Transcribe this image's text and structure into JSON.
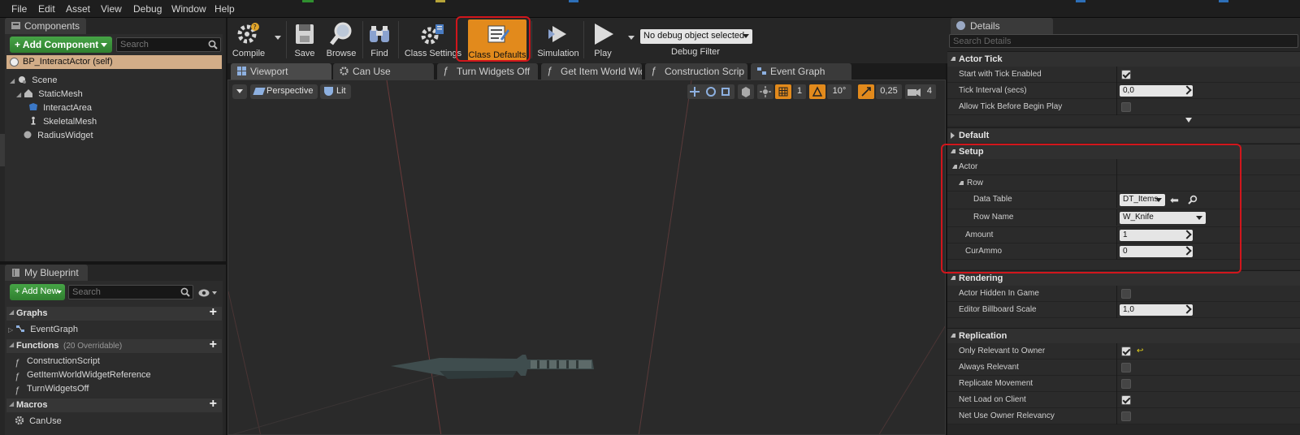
{
  "menu": [
    "File",
    "Edit",
    "Asset",
    "View",
    "Debug",
    "Window",
    "Help"
  ],
  "components_panel": {
    "tab": "Components",
    "add_button": "+ Add Component",
    "search_placeholder": "Search",
    "self_item": "BP_InteractActor (self)",
    "tree": [
      "Scene",
      "StaticMesh",
      "InteractArea",
      "SkeletalMesh",
      "RadiusWidget"
    ]
  },
  "blueprint_panel": {
    "tab": "My Blueprint",
    "add_button": "+ Add New",
    "search_placeholder": "Search",
    "graphs_label": "Graphs",
    "graphs": [
      "EventGraph"
    ],
    "functions_label": "Functions",
    "functions_note": "(20 Overridable)",
    "functions": [
      "ConstructionScript",
      "GetItemWorldWidgetReference",
      "TurnWidgetsOff"
    ],
    "macros_label": "Macros",
    "macros": [
      "CanUse"
    ]
  },
  "toolbar": {
    "compile": "Compile",
    "save": "Save",
    "browse": "Browse",
    "find": "Find",
    "class_settings": "Class Settings",
    "class_defaults": "Class Defaults",
    "simulation": "Simulation",
    "play": "Play",
    "debug_select": "No debug object selected",
    "debug_filter": "Debug Filter"
  },
  "editor_tabs": [
    "Viewport",
    "Can Use",
    "Turn Widgets Off",
    "Get Item World Wid",
    "Construction Scrip",
    "Event Graph"
  ],
  "viewport": {
    "perspective": "Perspective",
    "lit": "Lit",
    "grid_value": "1",
    "angle_value": "10°",
    "scale_value": "0,25",
    "camera_speed": "4"
  },
  "details": {
    "tab": "Details",
    "search_placeholder": "Search Details",
    "actor_tick": {
      "label": "Actor Tick",
      "start_with_tick": "Start with Tick Enabled",
      "start_with_tick_value": true,
      "tick_interval": "Tick Interval (secs)",
      "tick_interval_value": "0,0",
      "allow_tick": "Allow Tick Before Begin Play",
      "allow_tick_value": false
    },
    "default_label": "Default",
    "setup": {
      "label": "Setup",
      "actor": "Actor",
      "row": "Row",
      "data_table": "Data Table",
      "data_table_value": "DT_Items",
      "row_name": "Row Name",
      "row_name_value": "W_Knife",
      "amount": "Amount",
      "amount_value": "1",
      "cur_ammo": "CurAmmo",
      "cur_ammo_value": "0"
    },
    "rendering": {
      "label": "Rendering",
      "hidden": "Actor Hidden In Game",
      "hidden_value": false,
      "billboard": "Editor Billboard Scale",
      "billboard_value": "1,0"
    },
    "replication": {
      "label": "Replication",
      "only_relevant": "Only Relevant to Owner",
      "only_relevant_value": true,
      "always_relevant": "Always Relevant",
      "always_relevant_value": false,
      "replicate_movement": "Replicate Movement",
      "replicate_movement_value": false,
      "net_load": "Net Load on Client",
      "net_load_value": true,
      "net_use_owner": "Net Use Owner Relevancy",
      "net_use_owner_value": false
    }
  },
  "colors": {
    "accent_orange": "#e28a1c",
    "highlight_red": "#d1161c",
    "add_green": "#3a9a3a"
  }
}
